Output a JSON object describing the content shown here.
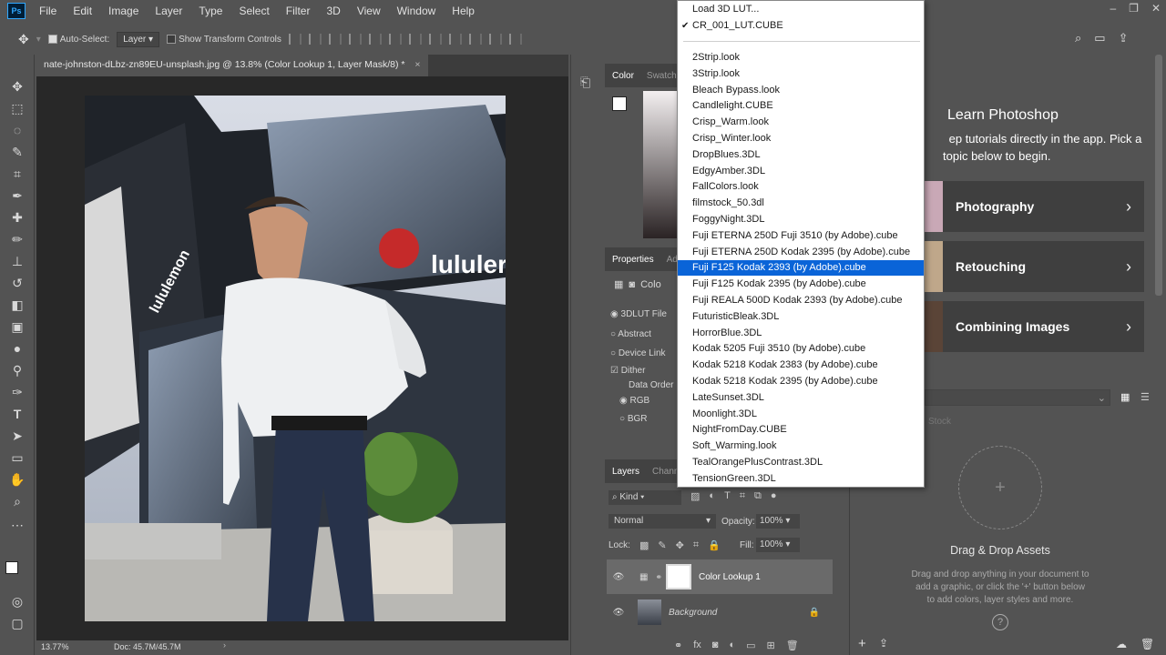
{
  "app": {
    "logo": "Ps"
  },
  "menu": [
    "File",
    "Edit",
    "Image",
    "Layer",
    "Type",
    "Select",
    "Filter",
    "3D",
    "View",
    "Window",
    "Help"
  ],
  "options": {
    "auto_select": "Auto-Select:",
    "auto_select_target": "Layer",
    "show_transform": "Show Transform Controls"
  },
  "document": {
    "tab_title": "nate-johnston-dLbz-zn89EU-unsplash.jpg @ 13.8% (Color Lookup 1, Layer Mask/8) *",
    "close": "×"
  },
  "status": {
    "zoom": "13.77%",
    "doc": "Doc: 45.7M/45.7M"
  },
  "photo_signage": {
    "brand": "lululer",
    "logo_text": "lululemon"
  },
  "color_panel": {
    "tab_color": "Color",
    "tab_swatches": "Swatch"
  },
  "properties": {
    "tab": "Properties",
    "tab2": "Ad",
    "header": "Colo",
    "opt_3dlut": "3DLUT File",
    "opt_abstract": "Abstract",
    "opt_devicelink": "Device Link",
    "dither": "Dither",
    "data_order": "Data Order",
    "rgb": "RGB",
    "bgr": "BGR"
  },
  "dropdown": {
    "top": [
      "Load 3D LUT...",
      "CR_001_LUT.CUBE"
    ],
    "items": [
      "2Strip.look",
      "3Strip.look",
      "Bleach Bypass.look",
      "Candlelight.CUBE",
      "Crisp_Warm.look",
      "Crisp_Winter.look",
      "DropBlues.3DL",
      "EdgyAmber.3DL",
      "FallColors.look",
      "filmstock_50.3dl",
      "FoggyNight.3DL",
      "Fuji ETERNA 250D Fuji 3510 (by Adobe).cube",
      "Fuji ETERNA 250D Kodak 2395 (by Adobe).cube",
      "Fuji F125 Kodak 2393 (by Adobe).cube",
      "Fuji F125 Kodak 2395 (by Adobe).cube",
      "Fuji REALA 500D Kodak 2393 (by Adobe).cube",
      "FuturisticBleak.3DL",
      "HorrorBlue.3DL",
      "Kodak 5205 Fuji 3510 (by Adobe).cube",
      "Kodak 5218 Kodak 2383 (by Adobe).cube",
      "Kodak 5218 Kodak 2395 (by Adobe).cube",
      "LateSunset.3DL",
      "Moonlight.3DL",
      "NightFromDay.CUBE",
      "Soft_Warming.look",
      "TealOrangePlusContrast.3DL",
      "TensionGreen.3DL"
    ],
    "selected_index": 13
  },
  "learn": {
    "title": "Learn Photoshop",
    "subtitle_line1": "ep tutorials directly in the app. Pick a",
    "subtitle_line2": "topic below to begin.",
    "cards": [
      "Photography",
      "Retouching",
      "Combining Images"
    ]
  },
  "libraries": {
    "stock_placeholder": "Stock",
    "drag_title": "Drag & Drop Assets",
    "drag_text1": "Drag and drop anything in your document to",
    "drag_text2": "add a graphic, or click the '+' button below",
    "drag_text3": "to add colors, layer styles and more.",
    "help": "?"
  },
  "layers": {
    "tab": "Layers",
    "tab2": "Chann",
    "kind": "Kind",
    "blend": "Normal",
    "opacity_label": "Opacity:",
    "opacity": "100%",
    "lock_label": "Lock:",
    "fill_label": "Fill:",
    "fill": "100%",
    "rows": [
      {
        "name": "Color Lookup 1"
      },
      {
        "name": "Background"
      }
    ]
  },
  "colors": {
    "accent": "#0a64d8",
    "panel": "#535353",
    "dark": "#282828"
  }
}
